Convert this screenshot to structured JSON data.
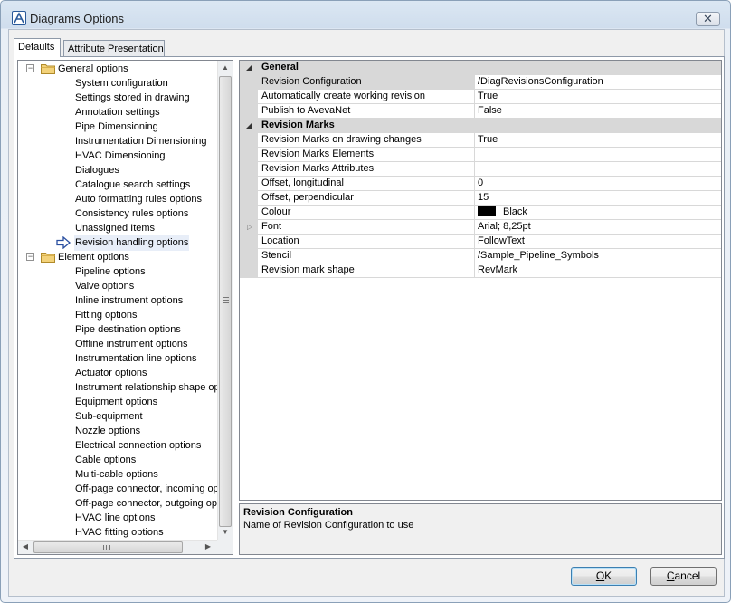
{
  "window": {
    "title": "Diagrams Options",
    "close_glyph": "✕"
  },
  "tabs": [
    {
      "label": "Defaults",
      "active": true
    },
    {
      "label": "Attribute Presentation",
      "active": false
    }
  ],
  "tree": {
    "groups": [
      {
        "label": "General options",
        "expanded": true,
        "items": [
          "System configuration",
          "Settings stored in drawing",
          "Annotation settings",
          "Pipe Dimensioning",
          "Instrumentation Dimensioning",
          "HVAC Dimensioning",
          "Dialogues",
          "Catalogue search settings",
          "Auto formatting rules options",
          "Consistency rules options",
          "Unassigned Items",
          "Revision handling options"
        ],
        "selected_index": 11
      },
      {
        "label": "Element options",
        "expanded": true,
        "items": [
          "Pipeline options",
          "Valve options",
          "Inline instrument options",
          "Fitting options",
          "Pipe destination options",
          "Offline instrument options",
          "Instrumentation line options",
          "Actuator options",
          "Instrument relationship shape opt",
          "Equipment options",
          "Sub-equipment",
          "Nozzle options",
          "Electrical connection options",
          "Cable options",
          "Multi-cable options",
          "Off-page connector, incoming op",
          "Off-page connector, outgoing op",
          "HVAC line options",
          "HVAC fitting options"
        ]
      }
    ],
    "scroll_up_glyph": "▲",
    "scroll_down_glyph": "▼",
    "scroll_left_glyph": "◀",
    "scroll_right_glyph": "▶"
  },
  "property_grid": {
    "categories": [
      {
        "label": "General",
        "rows": [
          {
            "name": "Revision Configuration",
            "value": "/DiagRevisionsConfiguration",
            "selected": true
          },
          {
            "name": "Automatically create working revision",
            "value": "True"
          },
          {
            "name": "Publish to AvevaNet",
            "value": "False"
          }
        ]
      },
      {
        "label": "Revision Marks",
        "rows": [
          {
            "name": "Revision Marks on drawing changes",
            "value": "True"
          },
          {
            "name": "Revision Marks Elements",
            "value": ""
          },
          {
            "name": "Revision Marks Attributes",
            "value": ""
          },
          {
            "name": "Offset, longitudinal",
            "value": "0"
          },
          {
            "name": "Offset, perpendicular",
            "value": "15"
          },
          {
            "name": "Colour",
            "value": "Black",
            "swatch": "#000000"
          },
          {
            "name": "Font",
            "value": "Arial; 8,25pt",
            "expandable": true
          },
          {
            "name": "Location",
            "value": "FollowText"
          },
          {
            "name": "Stencil",
            "value": "/Sample_Pipeline_Symbols"
          },
          {
            "name": "Revision mark shape",
            "value": "RevMark"
          }
        ]
      }
    ]
  },
  "description": {
    "title": "Revision Configuration",
    "text": "Name of Revision Configuration to use"
  },
  "buttons": {
    "ok_accel": "O",
    "ok_rest": "K",
    "cancel_accel": "C",
    "cancel_rest": "ancel"
  },
  "colors": {
    "category_bg": "#d8d8d8",
    "selection_bg": "#e8eef8",
    "ok_border": "#3c7fb1"
  }
}
